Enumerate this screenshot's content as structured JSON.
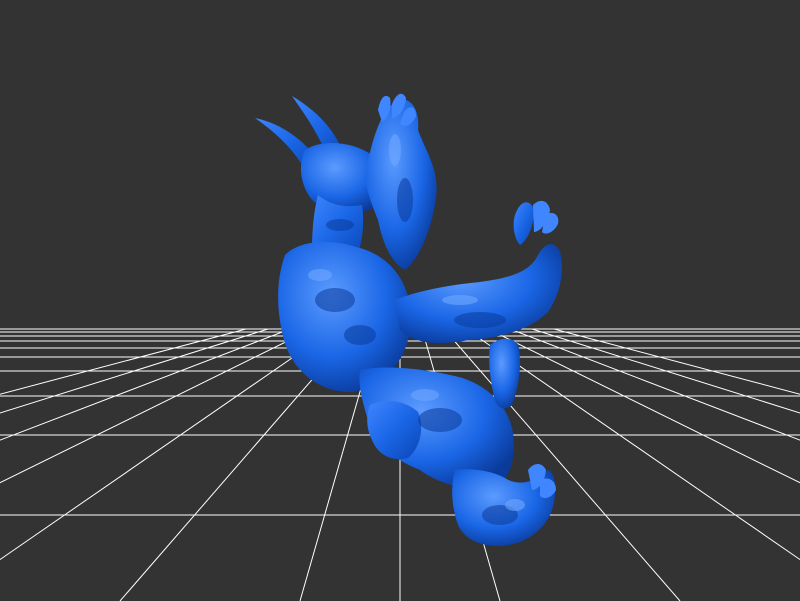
{
  "scene": {
    "background_color": "#333333",
    "grid_color": "#ffffff",
    "model_color": "#1a66e6",
    "model_highlight_color": "#4d8dff",
    "model_shadow_color": "#0a3a9a",
    "grid_visible": true,
    "model_description_icon": "mesh-model-icon"
  }
}
